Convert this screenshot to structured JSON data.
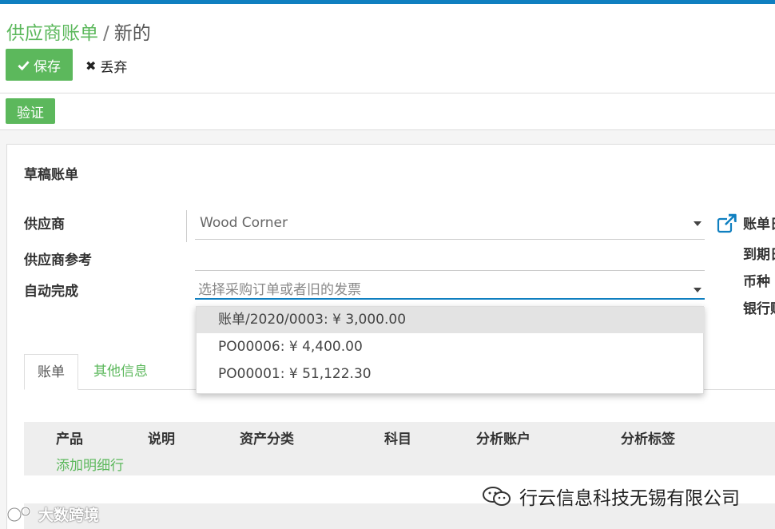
{
  "breadcrumb": {
    "parent": "供应商账单",
    "separator": "/",
    "current": "新的"
  },
  "toolbar": {
    "save_label": "保存",
    "discard_label": "丢弃"
  },
  "status_bar": {
    "verify_label": "验证"
  },
  "form": {
    "status_title": "草稿账单",
    "vendor_label": "供应商",
    "vendor_value": "Wood Corner",
    "vendor_ref_label": "供应商参考",
    "autocomplete_label": "自动完成",
    "autocomplete_placeholder": "选择采购订单或者旧的发票"
  },
  "right_labels": [
    "账单日期",
    "到期日期",
    "币种",
    "银行账户"
  ],
  "dropdown": {
    "items": [
      "账单/2020/0003: ¥ 3,000.00",
      "PO00006: ¥ 4,400.00",
      "PO00001: ¥ 51,122.30"
    ]
  },
  "tabs": [
    {
      "label": "账单"
    },
    {
      "label": "其他信息"
    }
  ],
  "table": {
    "headers": [
      "产品",
      "说明",
      "资产分类",
      "科目",
      "分析账户",
      "分析标签"
    ],
    "add_line": "添加明细行"
  },
  "watermarks": {
    "left": "大数跨境",
    "right": "行云信息科技无锡有限公司"
  },
  "colors": {
    "accent_green": "#5cb85c",
    "topbar_blue": "#0f7fc0"
  }
}
